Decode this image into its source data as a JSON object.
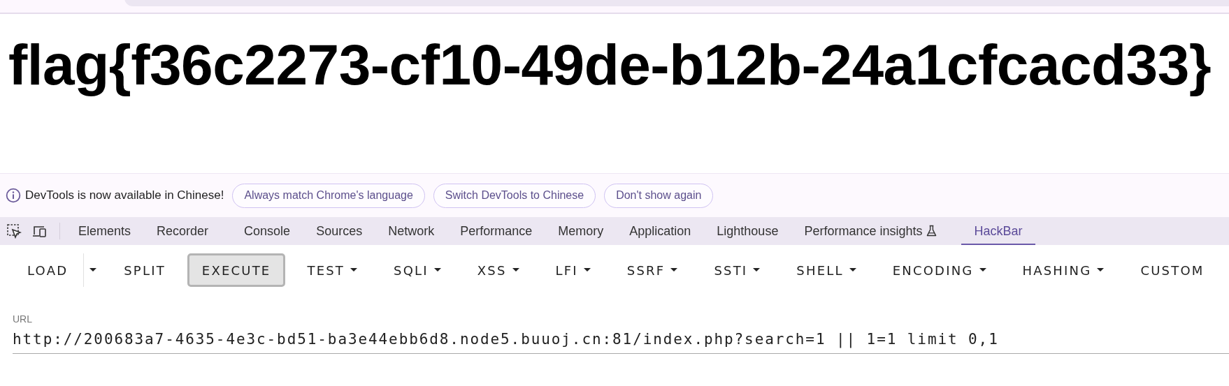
{
  "page": {
    "heading": "flag{f36c2273-cf10-49de-b12b-24a1cfcacd33}"
  },
  "devtools_notice": {
    "message": "DevTools is now available in Chinese!",
    "buttons": [
      "Always match Chrome's language",
      "Switch DevTools to Chinese",
      "Don't show again"
    ]
  },
  "devtools_tabs": [
    {
      "label": "Elements",
      "selected": false,
      "experimental": false
    },
    {
      "label": "Recorder",
      "selected": false,
      "experimental": false
    },
    {
      "label": "Console",
      "selected": false,
      "experimental": false
    },
    {
      "label": "Sources",
      "selected": false,
      "experimental": false
    },
    {
      "label": "Network",
      "selected": false,
      "experimental": false
    },
    {
      "label": "Performance",
      "selected": false,
      "experimental": false
    },
    {
      "label": "Memory",
      "selected": false,
      "experimental": false
    },
    {
      "label": "Application",
      "selected": false,
      "experimental": false
    },
    {
      "label": "Lighthouse",
      "selected": false,
      "experimental": false
    },
    {
      "label": "Performance insights",
      "selected": false,
      "experimental": true
    },
    {
      "label": "HackBar",
      "selected": true,
      "experimental": false
    }
  ],
  "hackbar_toolbar": [
    {
      "label": "LOAD",
      "kind": "split",
      "pressed": false
    },
    {
      "label": "SPLIT",
      "kind": "button",
      "pressed": false
    },
    {
      "label": "EXECUTE",
      "kind": "button",
      "pressed": true
    },
    {
      "label": "TEST",
      "kind": "menu",
      "pressed": false
    },
    {
      "label": "SQLI",
      "kind": "menu",
      "pressed": false
    },
    {
      "label": "XSS",
      "kind": "menu",
      "pressed": false
    },
    {
      "label": "LFI",
      "kind": "menu",
      "pressed": false
    },
    {
      "label": "SSRF",
      "kind": "menu",
      "pressed": false
    },
    {
      "label": "SSTI",
      "kind": "menu",
      "pressed": false
    },
    {
      "label": "SHELL",
      "kind": "menu",
      "pressed": false
    },
    {
      "label": "ENCODING",
      "kind": "menu",
      "pressed": false
    },
    {
      "label": "HASHING",
      "kind": "menu",
      "pressed": false
    },
    {
      "label": "CUSTOM",
      "kind": "button",
      "pressed": false
    }
  ],
  "url_field": {
    "label": "URL",
    "value": "http://200683a7-4635-4e3c-bd51-ba3e44ebb6d8.node5.buuoj.cn:81/index.php?search=1 || 1=1 limit 0,1"
  }
}
